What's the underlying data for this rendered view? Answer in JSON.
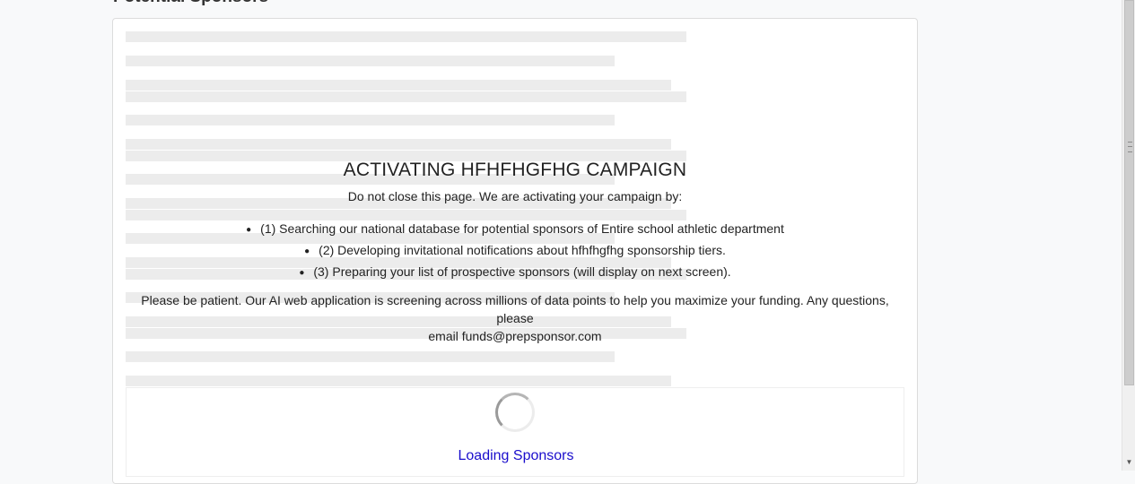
{
  "page": {
    "heading": "Potential Sponsors"
  },
  "overlay": {
    "title": "ACTIVATING HFHFHGFHG CAMPAIGN",
    "subtitle": "Do not close this page. We are activating your campaign by:",
    "steps": [
      "(1) Searching our national database for potential sponsors of Entire school athletic department",
      "(2) Developing invitational notifications about hfhfhgfhg sponsorship tiers.",
      "(3) Preparing your list of prospective sponsors (will display on next screen)."
    ],
    "patience_line1": "Please be patient. Our AI web application is screening across millions of data points to help you maximize your funding. Any questions, please",
    "patience_line2": "email funds@prepsponsor.com"
  },
  "loader": {
    "label": "Loading Sponsors"
  },
  "icons": {
    "spinner": "loading-spinner-icon",
    "bullet": "bullet-icon"
  },
  "colors": {
    "link": "#1a0dcc",
    "skeleton": "#ececec"
  }
}
